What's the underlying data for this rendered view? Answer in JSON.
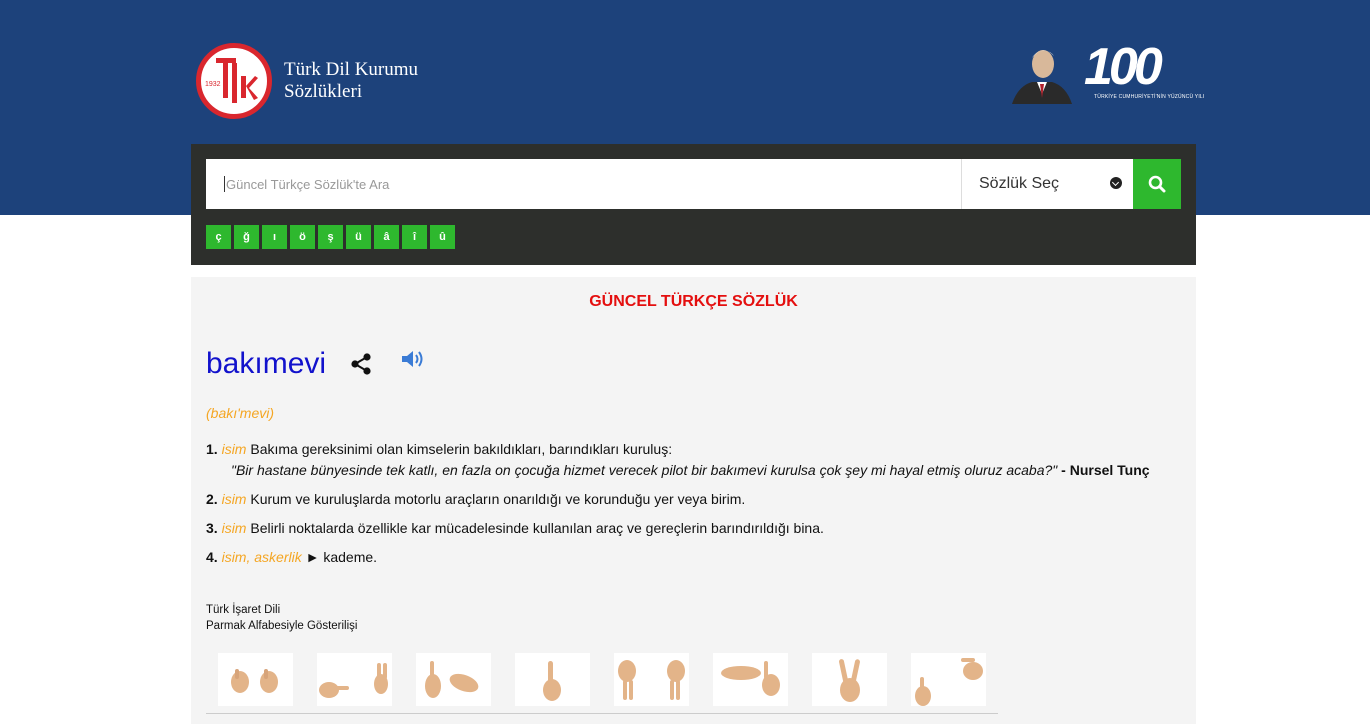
{
  "header": {
    "logo_year": "1932",
    "logo_letters": "TDK",
    "logo_text_line1": "Türk Dil Kurumu",
    "logo_text_line2": "Sözlükleri",
    "centennial_number": "100",
    "centennial_caption": "TÜRKİYE CUMHURİYETİ'NİN YÜZÜNCÜ YILI"
  },
  "search": {
    "placeholder": "Güncel Türkçe Sözlük'te Ara",
    "dictionary_select": "Sözlük Seç",
    "special_chars": [
      "ç",
      "ğ",
      "ı",
      "ö",
      "ş",
      "ü",
      "â",
      "î",
      "û"
    ]
  },
  "entry": {
    "dictionary_title": "GÜNCEL TÜRKÇE SÖZLÜK",
    "word": "bakımevi",
    "pronunciation": "(bakı'mevi)",
    "definitions": [
      {
        "num": "1.",
        "pos": "isim",
        "text": "Bakıma gereksinimi olan kimselerin bakıldıkları, barındıkları kuruluş:",
        "example": "\"Bir hastane bünyesinde tek katlı, en fazla on çocuğa hizmet verecek pilot bir bakımevi kurulsa çok şey mi hayal etmiş oluruz acaba?\"",
        "example_sep": " - ",
        "author": "Nursel Tunç"
      },
      {
        "num": "2.",
        "pos": "isim",
        "text": "Kurum ve kuruluşlarda motorlu araçların onarıldığı ve korunduğu yer veya birim."
      },
      {
        "num": "3.",
        "pos": "isim",
        "text": "Belirli noktalarda özellikle kar mücadelesinde kullanılan araç ve gereçlerin barındırıldığı bina."
      },
      {
        "num": "4.",
        "pos": "isim, askerlik",
        "arrow": "►",
        "text": "kademe."
      }
    ],
    "sign_language_line1": "Türk İşaret Dili",
    "sign_language_line2": "Parmak Alfabesiyle Gösterilişi",
    "fingerspelling_letters": [
      "b",
      "a",
      "k",
      "ı",
      "m",
      "e",
      "v",
      "i"
    ]
  },
  "colors": {
    "header_bg": "#1d427b",
    "search_panel_bg": "#2d2f2c",
    "accent_green": "#2eb82e",
    "title_red": "#e40f0f",
    "word_blue": "#1212cc",
    "pos_orange": "#f5a623"
  }
}
